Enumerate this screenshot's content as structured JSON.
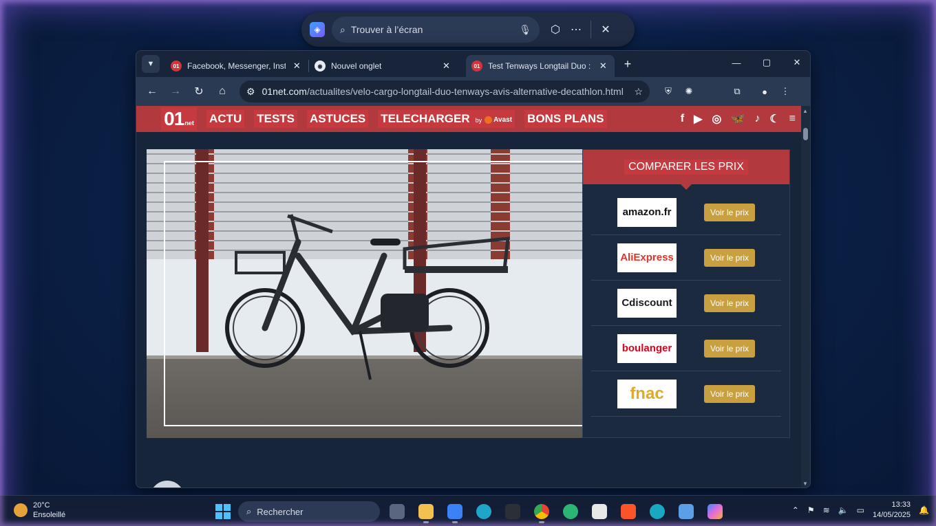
{
  "search_pill": {
    "placeholder": "Trouver à l’écran",
    "icons": [
      "google-lens-icon",
      "search-icon",
      "mic-icon",
      "cube-icon",
      "more-icon",
      "close-icon"
    ]
  },
  "tabs": [
    {
      "title": "Facebook, Messenger, Instagram",
      "favicon": "01"
    },
    {
      "title": "Nouvel onglet",
      "favicon": "chrome"
    },
    {
      "title": "Test Tenways Longtail Duo : ultra",
      "favicon": "01"
    }
  ],
  "address_bar": {
    "domain": "01net.com",
    "path": "/actualites/velo-cargo-longtail-duo-tenways-avis-alternative-decathlon.html"
  },
  "site": {
    "logo_text": "01",
    "logo_sup": "net",
    "nav": {
      "actu": "ACTU",
      "tests": "TESTS",
      "astuces": "ASTUCES",
      "telecharger": "TELECHARGER",
      "by": "by",
      "avast": "Avast",
      "bons_plans": "BONS PLANS"
    },
    "social": {
      "facebook": "f",
      "youtube": "▶",
      "instagram": "◎",
      "bluesky": "🦋",
      "tiktok": "♪",
      "theme": "☾",
      "menu": "≡"
    }
  },
  "compare": {
    "title": "COMPARER LES PRIX",
    "offers": [
      {
        "store": "amazon.fr",
        "button": "Voir le prix",
        "color": "#111111"
      },
      {
        "store": "AliExpress",
        "button": "Voir le prix",
        "color": "#e43225"
      },
      {
        "store": "Cdiscount",
        "button": "Voir le prix",
        "color": "#1a1a1a"
      },
      {
        "store": "boulanger",
        "button": "Voir le prix",
        "color": "#e3001b"
      },
      {
        "store": "fnac",
        "button": "Voir le prix",
        "color": "#e1a925"
      }
    ]
  },
  "taskbar": {
    "temperature": "20°C",
    "weather": "Ensoleillé",
    "search_placeholder": "Rechercher",
    "time": "13:33",
    "date": "14/05/2025"
  }
}
